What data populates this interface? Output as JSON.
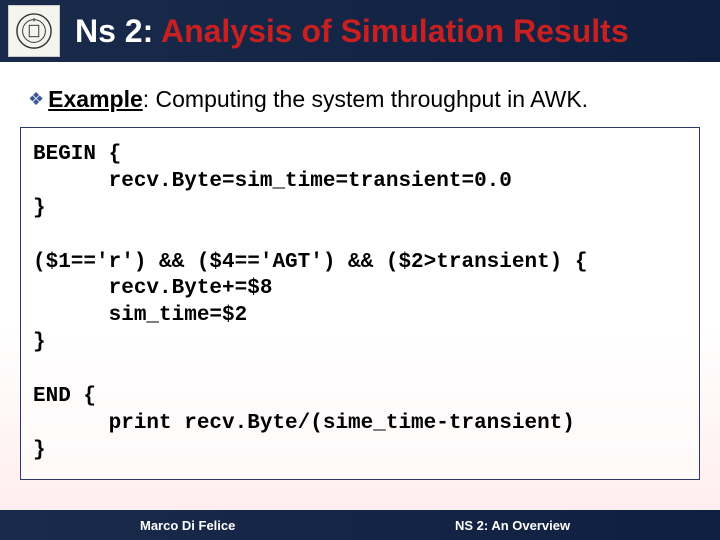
{
  "header": {
    "title_prefix": "Ns 2: ",
    "title_main": "Analysis of Simulation Results"
  },
  "example": {
    "bullet": "❖",
    "label": "Example",
    "colon": ": ",
    "text": "Computing the system throughput in AWK."
  },
  "code": {
    "l1": "BEGIN {",
    "l2": "      recv.Byte=sim_time=transient=0.0",
    "l3": "}",
    "l4": "",
    "l5": "($1=='r') && ($4=='AGT') && ($2>transient) {",
    "l6": "      recv.Byte+=$8",
    "l7": "      sim_time=$2",
    "l8": "}",
    "l9": "",
    "l10": "END {",
    "l11": "      print recv.Byte/(sime_time-transient)",
    "l12": "}"
  },
  "footer": {
    "author": "Marco Di Felice",
    "course": "NS 2: An Overview"
  }
}
